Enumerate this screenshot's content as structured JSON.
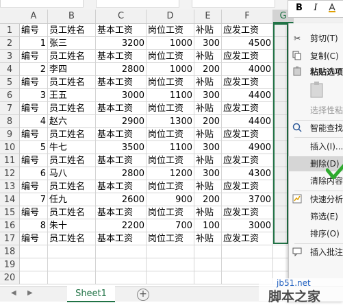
{
  "format_bar": {
    "bold": "B",
    "italic": "I"
  },
  "columns": [
    "A",
    "B",
    "C",
    "D",
    "E",
    "F",
    "G"
  ],
  "rows": [
    "1",
    "2",
    "3",
    "4",
    "5",
    "6",
    "7",
    "8",
    "9",
    "10",
    "11",
    "12",
    "13",
    "14",
    "15",
    "16",
    "17",
    "18",
    "19",
    "20"
  ],
  "header_row": [
    "编号",
    "员工姓名",
    "基本工资",
    "岗位工资",
    "补贴",
    "应发工资"
  ],
  "employees": [
    {
      "id": "1",
      "name": "张三",
      "base": "3200",
      "post": "1000",
      "bonus": "300",
      "total": "4500"
    },
    {
      "id": "2",
      "name": "李四",
      "base": "2800",
      "post": "1000",
      "bonus": "200",
      "total": "4000"
    },
    {
      "id": "3",
      "name": "王五",
      "base": "3000",
      "post": "1100",
      "bonus": "300",
      "total": "4400"
    },
    {
      "id": "4",
      "name": "赵六",
      "base": "2900",
      "post": "1300",
      "bonus": "200",
      "total": "4400"
    },
    {
      "id": "5",
      "name": "牛七",
      "base": "3500",
      "post": "1100",
      "bonus": "300",
      "total": "4900"
    },
    {
      "id": "6",
      "name": "马八",
      "base": "2800",
      "post": "1200",
      "bonus": "300",
      "total": "4300"
    },
    {
      "id": "7",
      "name": "任九",
      "base": "2600",
      "post": "900",
      "bonus": "200",
      "total": "3700"
    },
    {
      "id": "8",
      "name": "朱十",
      "base": "2200",
      "post": "700",
      "bonus": "100",
      "total": "3000"
    }
  ],
  "context_menu": {
    "cut": "剪切(T)",
    "copy": "复制(C)",
    "paste_options": "粘贴选项",
    "paste_special": "选择性粘",
    "smart_lookup": "智能查找",
    "insert": "插入(I)...",
    "delete": "删除(D)",
    "clear_contents": "清除内容",
    "quick_analysis": "快速分析",
    "filter": "筛选(E)",
    "sort": "排序(O)",
    "insert_comment": "插入批注"
  },
  "sheet_tab": "Sheet1",
  "watermark": {
    "url": "jb51.net",
    "brand": "脚本之家"
  },
  "colors": {
    "accent": "#217346",
    "check": "#2eaa2e"
  }
}
